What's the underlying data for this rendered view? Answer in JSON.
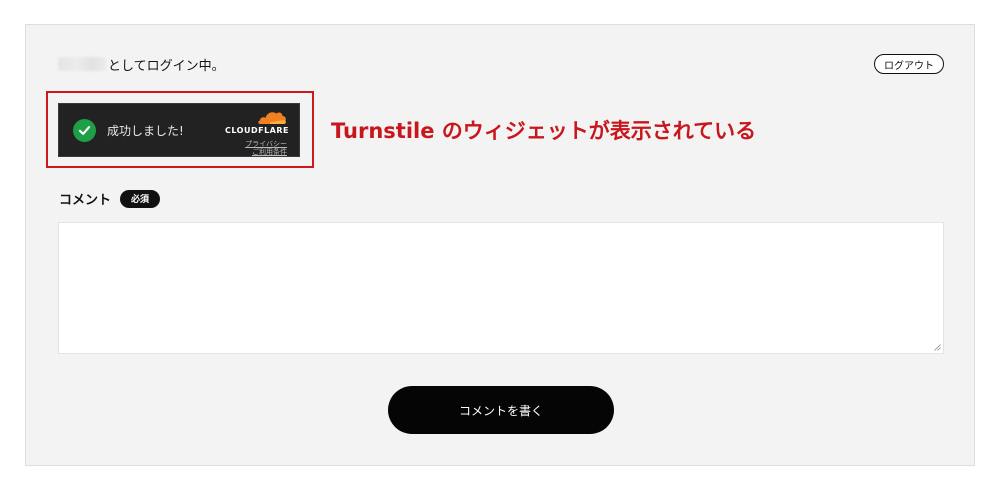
{
  "header": {
    "logged_in_suffix": "としてログイン中。",
    "logout_label": "ログアウト"
  },
  "turnstile": {
    "status_text": "成功しました!",
    "brand": "CLOUDFLARE",
    "privacy_link": "プライバシー",
    "terms_link": "ご利用条件",
    "brand_color": "#f38020",
    "success_color": "#1e9e46",
    "background_color": "#222222"
  },
  "annotation": {
    "text": "Turnstile のウィジェットが表示されている",
    "color": "#c8161d"
  },
  "comment_form": {
    "label": "コメント",
    "required_badge": "必須",
    "textarea_value": "",
    "submit_label": "コメントを書く"
  }
}
